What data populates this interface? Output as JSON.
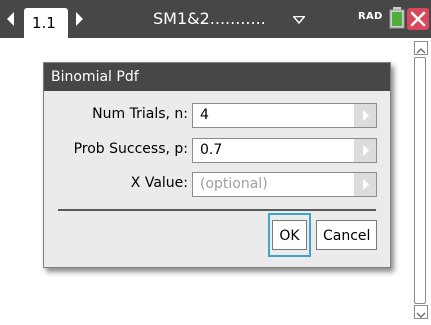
{
  "topbar": {
    "tab_label": "1.1",
    "document_title": "SM1&2...........",
    "mode": "RAD",
    "icons": [
      "nav-left-icon",
      "nav-right-icon",
      "dropdown-icon",
      "battery-icon",
      "close-icon"
    ]
  },
  "dialog": {
    "title": "Binomial Pdf",
    "fields": [
      {
        "label": "Num Trials, n:",
        "value": "4",
        "placeholder": ""
      },
      {
        "label": "Prob Success, p:",
        "value": "0.7",
        "placeholder": ""
      },
      {
        "label": "X Value:",
        "value": "",
        "placeholder": "(optional)"
      }
    ],
    "ok_label": "OK",
    "cancel_label": "Cancel"
  },
  "colors": {
    "bar": "#474747",
    "focus": "#3fa4c8",
    "close": "#d9485a",
    "battery": "#4caf3c"
  }
}
